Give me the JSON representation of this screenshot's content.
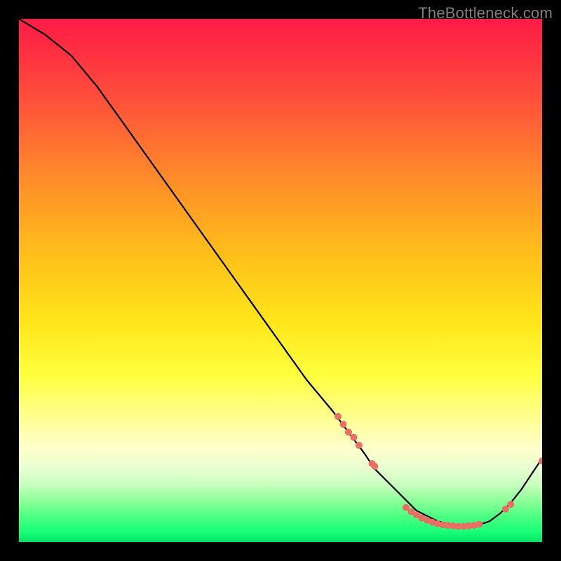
{
  "watermark": "TheBottleneck.com",
  "chart_data": {
    "type": "line",
    "title": "",
    "xlabel": "",
    "ylabel": "",
    "xlim": [
      0,
      100
    ],
    "ylim": [
      0,
      100
    ],
    "grid": false,
    "legend": false,
    "series": [
      {
        "name": "curve",
        "x": [
          0,
          5,
          10,
          15,
          20,
          25,
          30,
          35,
          40,
          45,
          50,
          55,
          60,
          63,
          66,
          68,
          70,
          72,
          74,
          76,
          78,
          80,
          82,
          84,
          86,
          88,
          90,
          92,
          94,
          96,
          98,
          100
        ],
        "y": [
          100,
          97,
          93,
          87,
          80,
          73,
          66,
          59,
          52,
          45,
          38,
          31,
          25,
          21,
          17,
          14,
          12,
          10,
          8,
          6,
          5,
          4,
          3.5,
          3,
          3,
          3.3,
          4,
          5.5,
          7.5,
          10,
          13,
          16
        ]
      }
    ],
    "markers": [
      {
        "name": "highlighted-points",
        "x": [
          61,
          62,
          63,
          64,
          65,
          67.5,
          68,
          74,
          75,
          76,
          77,
          78,
          79,
          80,
          81,
          82,
          83,
          84,
          85,
          86,
          87,
          88,
          93,
          94,
          100
        ],
        "y": [
          24,
          22.5,
          21,
          20,
          18.5,
          15,
          14.5,
          6.6,
          5.8,
          5.2,
          4.6,
          4.2,
          3.8,
          3.5,
          3.3,
          3.2,
          3.1,
          3,
          3,
          3.1,
          3.2,
          3.4,
          6.3,
          7.2,
          15.5
        ],
        "color": "#e86f63",
        "radius": 5
      }
    ],
    "colors": {
      "line": "#000000",
      "marker": "#e86f63"
    }
  }
}
